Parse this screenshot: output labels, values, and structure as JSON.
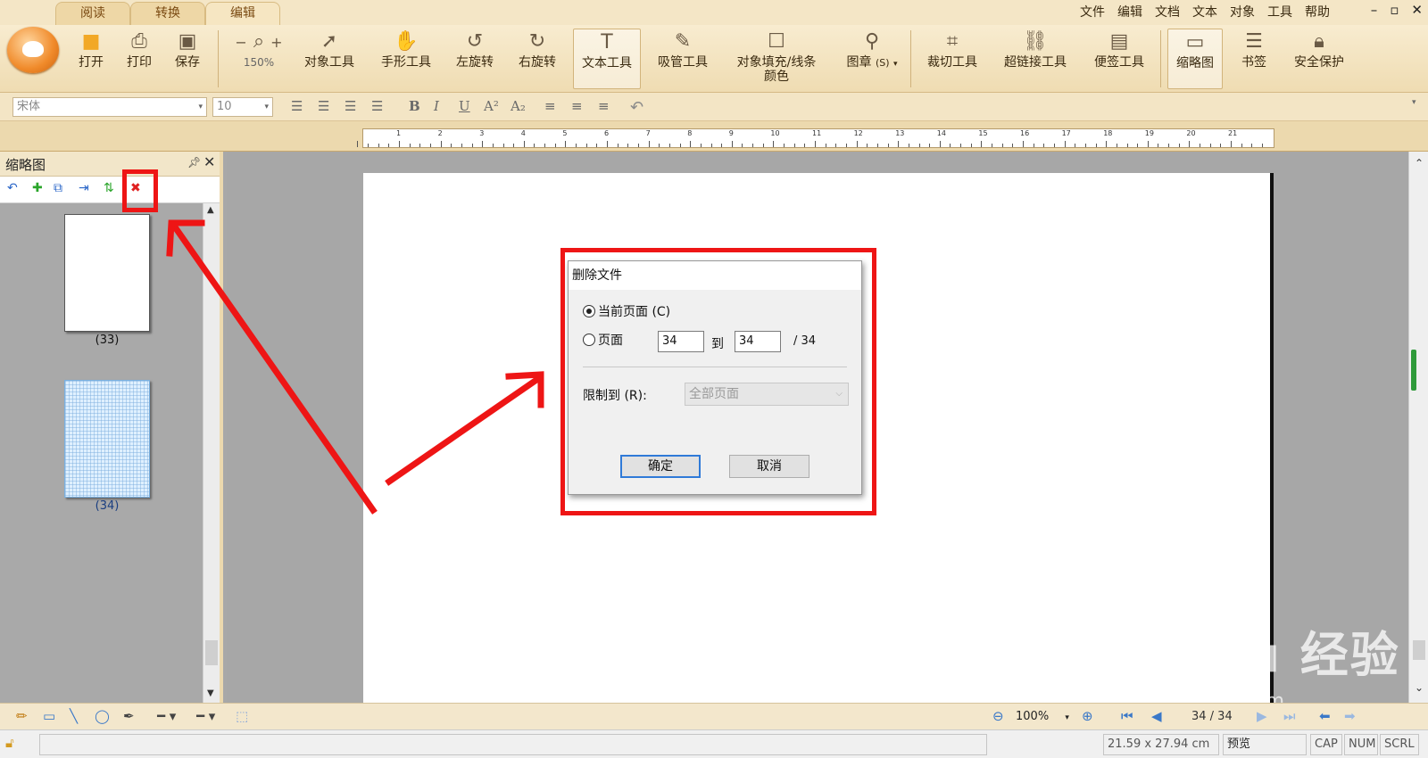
{
  "tabs": [
    "阅读",
    "转换",
    "编辑"
  ],
  "menu": [
    "文件",
    "编辑",
    "文档",
    "文本",
    "对象",
    "工具",
    "帮助"
  ],
  "window_controls": [
    "–",
    "▫",
    "✕"
  ],
  "ribbon": {
    "open": "打开",
    "print": "打印",
    "save": "保存",
    "zoom_level": "150%",
    "object_tool": "对象工具",
    "hand_tool": "手形工具",
    "rotate_left": "左旋转",
    "rotate_right": "右旋转",
    "text_tool": "文本工具",
    "eyedropper_tool": "吸管工具",
    "fill_stroke_line1": "对象填充/线条",
    "fill_stroke_line2": "颜色",
    "stamp": "图章",
    "stamp_shortcut": "(S)",
    "crop_tool": "裁切工具",
    "hyperlink_tool": "超链接工具",
    "note_tool": "便签工具",
    "thumbnails": "缩略图",
    "bookmarks": "书签",
    "security": "安全保护"
  },
  "format_bar": {
    "font": "宋体",
    "font_size": "10"
  },
  "ruler_ticks": [
    "1",
    "2",
    "3",
    "4",
    "5",
    "6",
    "7",
    "8",
    "9",
    "10",
    "11",
    "12",
    "13",
    "14",
    "15",
    "16",
    "17",
    "18",
    "19",
    "20",
    "21"
  ],
  "panel": {
    "title": "缩略图",
    "pin": "ᵖ",
    "close": "✕",
    "thumbnails": [
      {
        "label": "(33)"
      },
      {
        "label": "(34)"
      }
    ]
  },
  "dialog": {
    "title": "删除文件",
    "current_page": "当前页面 (C)",
    "pages": "页面",
    "from_value": "34",
    "to_label": "到",
    "to_value": "34",
    "total": "/   34",
    "limit_label": "限制到 (R):",
    "limit_value": "全部页面",
    "ok": "确定",
    "cancel": "取消"
  },
  "bottom": {
    "zoom": "100%",
    "page_indicator": "34 / 34"
  },
  "status": {
    "page_size": "21.59 x 27.94 cm",
    "preview": "预览",
    "cap": "CAP",
    "num": "NUM",
    "scrl": "SCRL"
  },
  "watermark": {
    "brand": "Bai du 经验",
    "url": "jingyan.baidu.com"
  },
  "colors": {
    "annotation": "#ee1515",
    "ribbon_bg": "#f3e5c5",
    "accent": "#2f7ad8"
  }
}
